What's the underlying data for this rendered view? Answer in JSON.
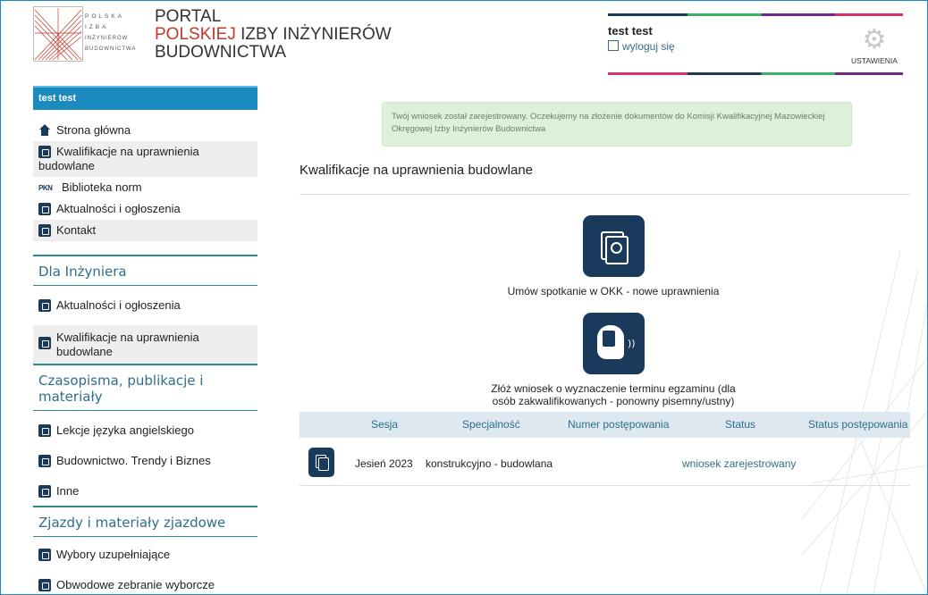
{
  "header": {
    "logo_words": [
      "POLSKA",
      "IZBA",
      "INŻYNIERÓW",
      "BUDOWNICTWA"
    ],
    "portal_line1": "PORTAL",
    "portal_line2_red": "POLSKIEJ",
    "portal_line2_rest": " IZBY INŻYNIERÓW",
    "portal_line3": "BUDOWNICTWA"
  },
  "user": {
    "name": "test test",
    "logout_label": "wyloguj się",
    "settings_label": "USTAWIENIA",
    "bar_colors": [
      "#1a3a5c",
      "#3fb06a",
      "#6b2a8a",
      "#d6336c"
    ]
  },
  "sidebar": {
    "head": "test test",
    "items": [
      {
        "label": "Strona główna",
        "icon": "home-icon"
      },
      {
        "label": "Kwalifikacje na uprawnienia budowlane",
        "icon": "document-clock-icon"
      },
      {
        "label": "Biblioteka norm",
        "icon": "pkn-icon"
      },
      {
        "label": "Aktualności i ogłoszenia",
        "icon": "newspaper-icon"
      },
      {
        "label": "Kontakt",
        "icon": "phone-icon"
      }
    ],
    "sections": [
      {
        "title": "Dla Inżyniera",
        "items": [
          {
            "label": "Aktualności i ogłoszenia"
          },
          {
            "label": "Kwalifikacje na uprawnienia budowlane"
          }
        ]
      },
      {
        "title": "Czasopisma, publikacje i materiały",
        "items": [
          {
            "label": "Lekcje języka angielskiego"
          },
          {
            "label": "Budownictwo. Trendy i Biznes"
          },
          {
            "label": "Inne"
          }
        ]
      },
      {
        "title": "Zjazdy i materiały zjazdowe",
        "items": [
          {
            "label": "Wybory uzupełniające"
          },
          {
            "label": "Obwodowe zebranie wyborcze"
          }
        ]
      }
    ]
  },
  "main": {
    "notice": "Twój wniosek został zarejestrowany. Oczekujemy na złożenie dokumentów do Komisji Kwalifikacyjnej Mazowieckiej Okręgowej Izby Inżynierów Budownictwa",
    "title": "Kwalifikacje na uprawnienia budowlane",
    "tile1_label": "Umów spotkanie w OKK - nowe uprawnienia",
    "tile2_label_line1": "Złóż wniosek o wyznaczenie terminu egzaminu (dla",
    "tile2_label_line2": "osób zakwalifikowanych - ponowny pisemny/ustny)",
    "table": {
      "headers": [
        "Sesja",
        "Specjalność",
        "Numer postępowania",
        "Status",
        "Status postępowania"
      ],
      "rows": [
        {
          "sesja": "Jesień 2023",
          "specjalnosc": "konstrukcyjno - budowlana",
          "numer": "",
          "status": "wniosek zarejestrowany",
          "status_postepowania": ""
        }
      ]
    }
  }
}
